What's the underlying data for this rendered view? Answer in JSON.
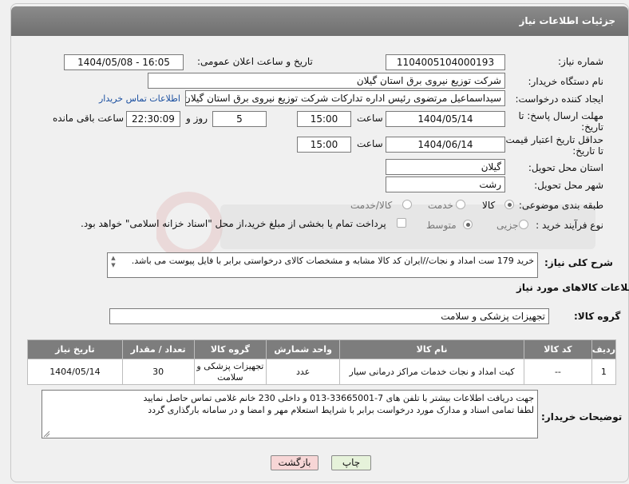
{
  "page_title": "جزئیات اطلاعات نیاز",
  "fields": {
    "need_number_label": "شماره نیاز:",
    "need_number": "1104005104000193",
    "announce_label": "تاریخ و ساعت اعلان عمومی:",
    "announce_value": "1404/05/08 - 16:05",
    "buyer_org_label": "نام دستگاه خریدار:",
    "buyer_org": "شرکت توزیع نیروی برق استان گیلان",
    "creator_label": "ایجاد کننده درخواست:",
    "creator": "سیداسماعیل مرتضوی رئیس اداره تدارکات شرکت توزیع نیروی برق استان گیلان",
    "buyer_contact_link": "اطلاعات تماس خریدار",
    "deadline_label_1": "مهلت ارسال پاسخ: تا",
    "deadline_label_2": "تاریخ:",
    "deadline_date": "1404/05/14",
    "time_label": "ساعت",
    "deadline_time": "15:00",
    "days_value": "5",
    "days_label": "روز و",
    "remaining_time": "22:30:09",
    "remaining_label": "ساعت باقی مانده",
    "min_price_label_1": "حداقل تاریخ اعتبار قیمت:",
    "min_price_label_2": "تا تاریخ:",
    "min_price_date": "1404/06/14",
    "min_price_time": "15:00",
    "province_label": "استان محل تحویل:",
    "province": "گیلان",
    "city_label": "شهر محل تحویل:",
    "city": "رشت",
    "category_label": "طبقه بندی موضوعی:",
    "category_options": [
      "کالا",
      "خدمت",
      "کالا/خدمت"
    ],
    "process_label": "نوع فرآیند خرید :",
    "process_options": [
      "جزیی",
      "متوسط"
    ],
    "payment_note": "پرداخت تمام یا بخشی از مبلغ خرید،از محل \"اسناد خزانه اسلامی\" خواهد بود."
  },
  "description": {
    "label": "شرح کلی نیاز:",
    "text": "خرید 179 ست امداد و نجات//ایران کد کالا مشابه و مشخصات کالای درخواستی برابر با فایل پیوست می باشد."
  },
  "goods": {
    "section_title": "اطلاعات کالاهای مورد نیاز",
    "group_label": "گروه کالا:",
    "group_value": "تجهیزات پزشکی و سلامت",
    "columns": [
      "ردیف",
      "کد کالا",
      "نام کالا",
      "واحد شمارش",
      "گروه کالا",
      "تعداد / مقدار",
      "تاریخ نیاز"
    ],
    "rows": [
      {
        "row": "1",
        "code": "--",
        "name": "کیت امداد و نجات خدمات مراکز درمانی سیار",
        "unit": "عدد",
        "group": "تجهیزات پزشکی و سلامت",
        "qty": "30",
        "date": "1404/05/14"
      }
    ]
  },
  "buyer_notes": {
    "label": "توضیحات خریدار:",
    "line1": "جهت دریافت اطلاعات بیشتر با تلفن های 7-33665001-013 و داخلی 230 خانم غلامی تماس حاصل نمایید",
    "line2": "لطفا تمامی اسناد و مدارک مورد درخواست برابر با شرایط استعلام مهر و امضا و در سامانه بارگذاری گردد"
  },
  "buttons": {
    "print": "چاپ",
    "back": "بازگشت"
  },
  "colors": {
    "header": "#7d7d7d",
    "link": "#1a4fa0",
    "back_button": "#f7d6d6",
    "print_button": "#e6f2da"
  }
}
